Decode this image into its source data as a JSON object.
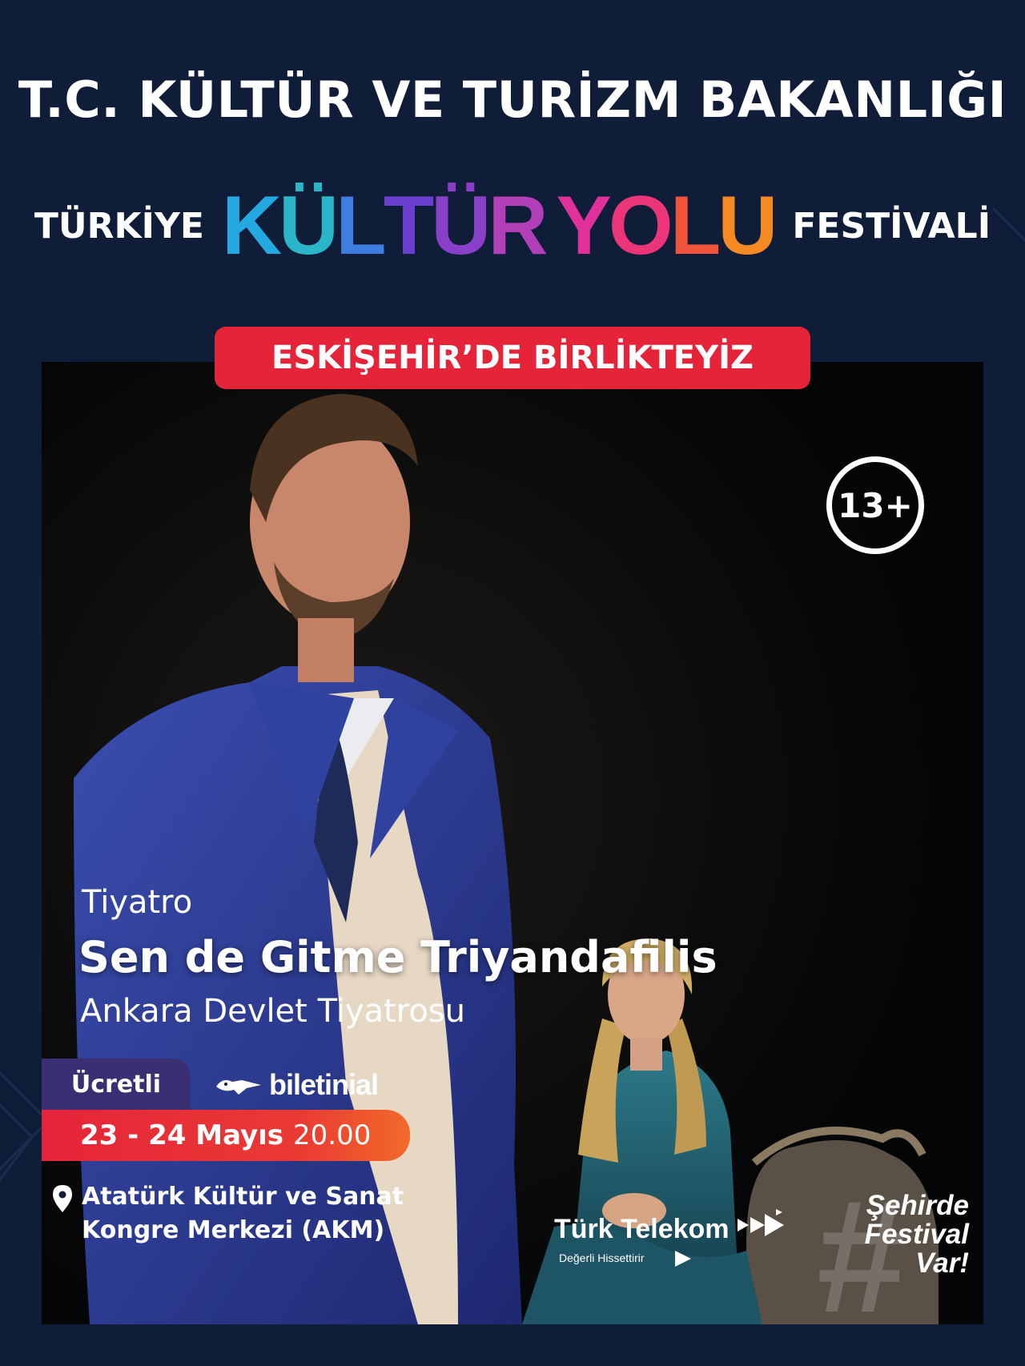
{
  "header": {
    "ministry": "T.C. KÜLTÜR VE TURİZM BAKANLIĞI",
    "festival_prefix": "TÜRKİYE",
    "festival_logo_letters": [
      {
        "ch": "K",
        "color": "#23a8e0"
      },
      {
        "ch": "Ü",
        "color": "#2bb5c9"
      },
      {
        "ch": "L",
        "color": "#3f7de0"
      },
      {
        "ch": "T",
        "color": "#6a3fd0"
      },
      {
        "ch": "Ü",
        "color": "#8a3fc8"
      },
      {
        "ch": "R",
        "color": "#b03fb8"
      },
      {
        "ch": "Y",
        "color": "#e0309a"
      },
      {
        "ch": "O",
        "color": "#ec3478"
      },
      {
        "ch": "L",
        "color": "#f0533c"
      },
      {
        "ch": "U",
        "color": "#f58a22"
      }
    ],
    "festival_suffix": "FESTİVALİ",
    "city_badge": "ESKİŞEHİR’DE BİRLİKTEYİZ"
  },
  "event": {
    "age_rating": "13+",
    "genre": "Tiyatro",
    "title": "Sen de Gitme Triyandafilis",
    "company": "Ankara Devlet Tiyatrosu",
    "price": "Ücretli",
    "ticket_vendor": "biletinial",
    "dates": "23 - 24 Mayıs",
    "time": "20.00",
    "venue_line1": "Atatürk Kültür ve Sanat",
    "venue_line2": "Kongre Merkezi (AKM)"
  },
  "footer": {
    "sponsor_name": "Türk Telekom",
    "sponsor_slogan": "Değerli Hissettirir",
    "slogan_line1": "Şehirde",
    "slogan_line2": "Festival",
    "slogan_line3": "Var!"
  },
  "colors": {
    "background": "#0f1d38",
    "badge_red": "#e5243a",
    "price_purple": "#3b2f74",
    "date_orange": "#f26a2a"
  },
  "icons": [
    "location-pin-icon",
    "bird-logo-icon",
    "play-arrows-icon"
  ]
}
